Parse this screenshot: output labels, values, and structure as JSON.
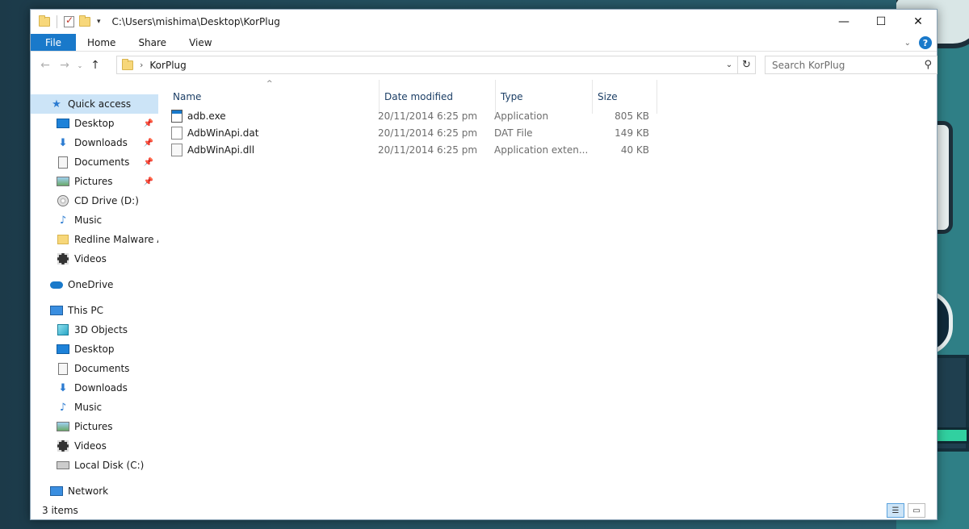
{
  "window": {
    "title_path": "C:\\Users\\mishima\\Desktop\\KorPlug",
    "controls": {
      "minimize": "—",
      "maximize": "☐",
      "close": "✕"
    }
  },
  "ribbon": {
    "file_label": "File",
    "tabs": [
      "Home",
      "Share",
      "View"
    ],
    "help": "?",
    "collapse": "⌄"
  },
  "navbar": {
    "back": "←",
    "forward": "→",
    "recent": "⌄",
    "up": "↑",
    "address": "KorPlug",
    "refresh": "↻",
    "dropdown": "⌄"
  },
  "search": {
    "placeholder": "Search KorPlug",
    "icon": "⚲"
  },
  "sidebar": {
    "quick_access": "Quick access",
    "quick_items": [
      {
        "label": "Desktop",
        "icon": "monitor",
        "pinned": true
      },
      {
        "label": "Downloads",
        "icon": "download",
        "pinned": true
      },
      {
        "label": "Documents",
        "icon": "document",
        "pinned": true
      },
      {
        "label": "Pictures",
        "icon": "picture",
        "pinned": true
      },
      {
        "label": "CD Drive (D:)",
        "icon": "cd",
        "pinned": false
      },
      {
        "label": "Music",
        "icon": "music",
        "pinned": false
      },
      {
        "label": "Redline Malware Ar",
        "icon": "folder",
        "pinned": false
      },
      {
        "label": "Videos",
        "icon": "video",
        "pinned": false
      }
    ],
    "onedrive": "OneDrive",
    "this_pc": "This PC",
    "pc_items": [
      {
        "label": "3D Objects"
      },
      {
        "label": "Desktop"
      },
      {
        "label": "Documents"
      },
      {
        "label": "Downloads"
      },
      {
        "label": "Music"
      },
      {
        "label": "Pictures"
      },
      {
        "label": "Videos"
      },
      {
        "label": "Local Disk (C:)"
      }
    ],
    "network": "Network"
  },
  "columns": {
    "name": "Name",
    "date": "Date modified",
    "type": "Type",
    "size": "Size",
    "sort_indicator": "^"
  },
  "files": [
    {
      "name": "adb.exe",
      "date": "20/11/2014 6:25 pm",
      "type": "Application",
      "size": "805 KB"
    },
    {
      "name": "AdbWinApi.dat",
      "date": "20/11/2014 6:25 pm",
      "type": "DAT File",
      "size": "149 KB"
    },
    {
      "name": "AdbWinApi.dll",
      "date": "20/11/2014 6:25 pm",
      "type": "Application exten...",
      "size": "40 KB"
    }
  ],
  "status": {
    "item_count": "3 items"
  },
  "colors": {
    "accent": "#1979ca",
    "selection": "#cce4f7"
  }
}
